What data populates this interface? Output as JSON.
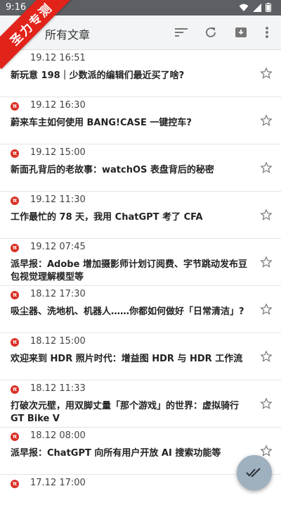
{
  "statusbar": {
    "time": "9:16"
  },
  "ribbon": {
    "text": "圣力专测"
  },
  "toolbar": {
    "title": "所有文章"
  },
  "articles": [
    {
      "date": "19.12 16:51",
      "title": "新玩意 198｜少数派的编辑们最近买了啥?"
    },
    {
      "date": "19.12 16:30",
      "title": "蔚来车主如何使用 BANG!CASE 一键控车?"
    },
    {
      "date": "19.12 15:00",
      "title": "新面孔背后的老故事：watchOS 表盘背后的秘密"
    },
    {
      "date": "19.12 11:30",
      "title": "工作最忙的 78 天，我用 ChatGPT 考了 CFA"
    },
    {
      "date": "19.12 07:45",
      "title": "派早报：Adobe 增加摄影师计划订阅费、字节跳动发布豆包视觉理解模型等"
    },
    {
      "date": "18.12 17:30",
      "title": "吸尘器、洗地机、机器人……你都如何做好「日常清洁」?"
    },
    {
      "date": "18.12 15:00",
      "title": "欢迎来到 HDR 照片时代：增益图 HDR 与 HDR 工作流"
    },
    {
      "date": "18.12 11:33",
      "title": "打破次元壁，用双脚丈量「那个游戏」的世界：虚拟骑行 GT Bike V"
    },
    {
      "date": "18.12 08:00",
      "title": "派早报：ChatGPT 向所有用户开放 AI 搜索功能等"
    },
    {
      "date": "17.12 17:00",
      "title": ""
    }
  ],
  "icons": {
    "source_badge": "π",
    "accent": "#d93025"
  }
}
